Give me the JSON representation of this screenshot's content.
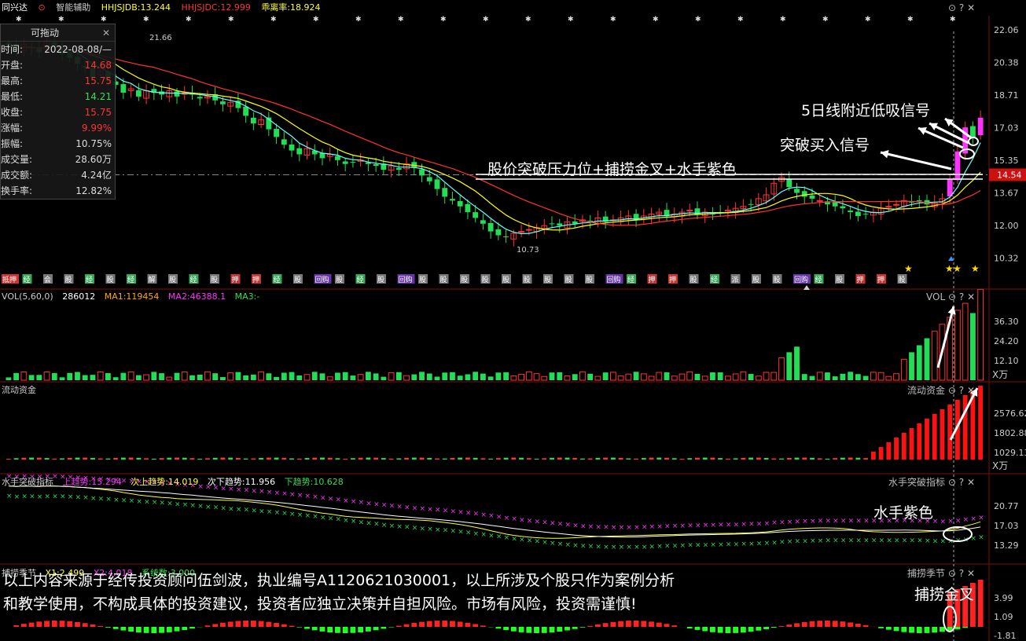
{
  "header": {
    "stock_name": "同兴达",
    "assist_label": "智能辅助",
    "hhjsjdb": "HHJSJDB:13.244",
    "hhjsjdc": "HHJSJDC:12.999",
    "deviation": "乖离率:18.924"
  },
  "drag_box": {
    "title": "可拖动",
    "rows": [
      {
        "k": "时间:",
        "v": "2022-08-08/—",
        "c": "w"
      },
      {
        "k": "开盘:",
        "v": "14.68",
        "c": "r"
      },
      {
        "k": "最高:",
        "v": "15.75",
        "c": "r"
      },
      {
        "k": "最低:",
        "v": "14.21",
        "c": "g"
      },
      {
        "k": "收盘:",
        "v": "15.75",
        "c": "r"
      },
      {
        "k": "涨幅:",
        "v": "9.99%",
        "c": "r"
      },
      {
        "k": "振幅:",
        "v": "10.75%",
        "c": "w"
      },
      {
        "k": "成交量:",
        "v": "28.60万",
        "c": "w"
      },
      {
        "k": "成交额:",
        "v": "4.24亿",
        "c": "w"
      },
      {
        "k": "换手率:",
        "v": "12.82%",
        "c": "w"
      }
    ]
  },
  "annotations": {
    "breakout_text": "股价突破压力位+捕捞金叉+水手紫色",
    "buy_signal": "突破买入信号",
    "ma5_signal": "5日线附近低吸信号",
    "purple_label": "水手紫色",
    "golden_cross": "捕捞金叉",
    "disclaimer_line1": "以上内容来源于经传投资顾问伍剑波，执业编号A1120621030001，以上所涉及个股只作为案例分析",
    "disclaimer_line2": "和教学使用，不构成具体的投资建议，投资者应独立决策并自担风险。市场有风险，投资需谨慎!"
  },
  "main_panel": {
    "y_labels": [
      "22.06",
      "20.38",
      "18.71",
      "17.03",
      "15.35",
      "13.67",
      "12.00",
      "10.32"
    ],
    "current_price": "14.54",
    "high_label": "21.66",
    "low_label": "10.73",
    "event_tags": [
      "抵押",
      "经",
      "会",
      "股",
      "经",
      "股",
      "经",
      "解",
      "股",
      "经",
      "股",
      "押",
      "押",
      "经",
      "股",
      "回购",
      "股",
      "经",
      "股",
      "回购",
      "股",
      "股",
      "股",
      "股",
      "股",
      "股",
      "股",
      "股",
      "股",
      "回购",
      "经",
      "押",
      "押",
      "股",
      "经",
      "派",
      "股",
      "股",
      "回购",
      "经",
      "股",
      "押",
      "押",
      "股"
    ]
  },
  "vol_panel": {
    "title": "VOL(5,60,0)",
    "vol": "286012",
    "ma1": "MA1:119454",
    "ma2": "MA2:46388.1",
    "ma3": "MA3:-",
    "name": "VOL",
    "y_labels": [
      "36.30",
      "24.20",
      "12.10"
    ],
    "unit": "X万"
  },
  "flow_panel": {
    "title": "流动资金",
    "y_labels": [
      "2576.62",
      "1802.88",
      "1029.13"
    ],
    "unit": "X万"
  },
  "sailor_panel": {
    "title": "水手突破指标",
    "up": "上趋势:15.294",
    "up2": "次上趋势:14.019",
    "down2": "次下趋势:11.956",
    "down": "下趋势:10.628",
    "y_labels": [
      "20.77",
      "17.03",
      "13.29"
    ]
  },
  "season_panel": {
    "title": "捕捞季节",
    "x1": "X1:2.499",
    "x2": "X2:4.018",
    "extra": "系统数:3.000",
    "y_labels": [
      "3.99",
      "1.09",
      "-1.81"
    ]
  },
  "colors": {
    "up": "#ff3333",
    "down": "#22dd55",
    "ma5": "#ffffff",
    "ma10": "#ffff00",
    "ma20": "#ff33ff",
    "ma30": "#00cc66",
    "magenta": "#ff33ff"
  },
  "chart_data": {
    "type": "candlestick",
    "ylim": [
      10.32,
      22.06
    ],
    "closes": [
      21.2,
      21.0,
      21.3,
      21.1,
      20.9,
      21.5,
      21.2,
      20.8,
      20.6,
      20.3,
      20.1,
      19.6,
      19.9,
      19.5,
      19.2,
      18.8,
      19.0,
      18.6,
      18.9,
      18.8,
      18.7,
      18.9,
      18.6,
      18.8,
      18.7,
      18.5,
      18.6,
      18.4,
      18.2,
      18.3,
      18.0,
      17.6,
      17.2,
      17.4,
      16.9,
      16.5,
      16.1,
      15.8,
      15.6,
      15.9,
      15.6,
      15.4,
      15.6,
      15.3,
      15.1,
      15.2,
      15.3,
      15.1,
      15.0,
      14.8,
      15.0,
      14.8,
      15.1,
      14.9,
      14.5,
      14.2,
      13.8,
      13.4,
      13.2,
      12.9,
      12.6,
      12.3,
      12.0,
      11.6,
      11.4,
      11.3,
      11.5,
      11.6,
      11.7,
      11.8,
      11.9,
      12.0,
      11.9,
      12.1,
      12.0,
      12.2,
      12.1,
      12.3,
      12.1,
      12.2,
      12.3,
      12.4,
      12.2,
      12.4,
      12.5,
      12.6,
      12.4,
      12.5,
      12.6,
      12.7,
      12.5,
      12.6,
      12.5,
      12.6,
      12.7,
      12.8,
      12.9,
      13.0,
      13.3,
      13.5,
      14.1,
      14.4,
      13.9,
      13.6,
      13.4,
      13.3,
      13.2,
      13.0,
      12.9,
      12.8,
      12.6,
      12.4,
      12.5,
      12.6,
      12.8,
      12.9,
      13.0,
      13.2,
      13.1,
      13.2,
      13.0,
      13.1,
      13.3,
      14.3,
      15.75,
      17.0,
      16.5,
      17.5
    ]
  }
}
